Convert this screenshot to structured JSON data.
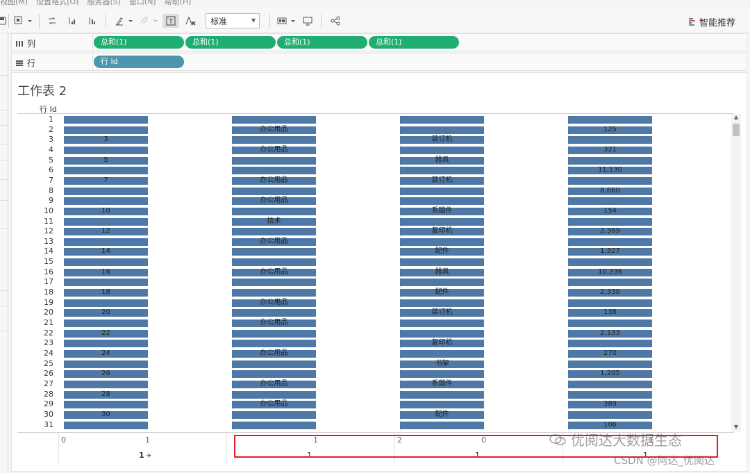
{
  "menu": [
    "视图(M)",
    "设置格式(O)",
    "服务器(S)",
    "窗口(N)",
    "帮助(H)"
  ],
  "toolbar": {
    "mark_type_select": "标准",
    "smart_recommend": "智能推荐"
  },
  "shelves": {
    "columns_label": "列",
    "rows_label": "行",
    "column_pills": [
      "总和(1)",
      "总和(1)",
      "总和(1)",
      "总和(1)"
    ],
    "row_pill": "行 Id"
  },
  "sheet": {
    "title": "工作表 2",
    "row_header": "行 Id",
    "bar_color": "#4e79a7"
  },
  "rows": [
    {
      "id": "1",
      "c1": "",
      "c2": "",
      "c3": "",
      "c4": ""
    },
    {
      "id": "2",
      "c1": "",
      "c2": "办公用品",
      "c3": "",
      "c4": "125"
    },
    {
      "id": "3",
      "c1": "3",
      "c2": "",
      "c3": "装订机",
      "c4": ""
    },
    {
      "id": "4",
      "c1": "",
      "c2": "办公用品",
      "c3": "",
      "c4": "321"
    },
    {
      "id": "5",
      "c1": "5",
      "c2": "",
      "c3": "器具",
      "c4": ""
    },
    {
      "id": "6",
      "c1": "",
      "c2": "",
      "c3": "",
      "c4": "11,130"
    },
    {
      "id": "7",
      "c1": "7",
      "c2": "办公用品",
      "c3": "装订机",
      "c4": ""
    },
    {
      "id": "8",
      "c1": "",
      "c2": "",
      "c3": "",
      "c4": "8,660"
    },
    {
      "id": "9",
      "c1": "",
      "c2": "办公用品",
      "c3": "",
      "c4": ""
    },
    {
      "id": "10",
      "c1": "10",
      "c2": "",
      "c3": "系固件",
      "c4": "154"
    },
    {
      "id": "11",
      "c1": "",
      "c2": "技术",
      "c3": "",
      "c4": ""
    },
    {
      "id": "12",
      "c1": "12",
      "c2": "",
      "c3": "复印机",
      "c4": "2,369"
    },
    {
      "id": "13",
      "c1": "",
      "c2": "办公用品",
      "c3": "",
      "c4": ""
    },
    {
      "id": "14",
      "c1": "14",
      "c2": "",
      "c3": "配件",
      "c4": "1,327"
    },
    {
      "id": "15",
      "c1": "",
      "c2": "",
      "c3": "",
      "c4": ""
    },
    {
      "id": "16",
      "c1": "16",
      "c2": "办公用品",
      "c3": "器具",
      "c4": "10,336"
    },
    {
      "id": "17",
      "c1": "",
      "c2": "",
      "c3": "",
      "c4": ""
    },
    {
      "id": "18",
      "c1": "18",
      "c2": "",
      "c3": "配件",
      "c4": "2,330"
    },
    {
      "id": "19",
      "c1": "",
      "c2": "办公用品",
      "c3": "",
      "c4": ""
    },
    {
      "id": "20",
      "c1": "20",
      "c2": "",
      "c3": "装订机",
      "c4": "138"
    },
    {
      "id": "21",
      "c1": "",
      "c2": "办公用品",
      "c3": "",
      "c4": ""
    },
    {
      "id": "22",
      "c1": "22",
      "c2": "",
      "c3": "",
      "c4": "2,133"
    },
    {
      "id": "23",
      "c1": "",
      "c2": "",
      "c3": "复印机",
      "c4": ""
    },
    {
      "id": "24",
      "c1": "24",
      "c2": "办公用品",
      "c3": "",
      "c4": "270"
    },
    {
      "id": "25",
      "c1": "",
      "c2": "",
      "c3": "书架",
      "c4": ""
    },
    {
      "id": "26",
      "c1": "26",
      "c2": "",
      "c3": "",
      "c4": "1,205"
    },
    {
      "id": "27",
      "c1": "",
      "c2": "办公用品",
      "c3": "系固件",
      "c4": ""
    },
    {
      "id": "28",
      "c1": "28",
      "c2": "",
      "c3": "",
      "c4": ""
    },
    {
      "id": "29",
      "c1": "",
      "c2": "办公用品",
      "c3": "",
      "c4": "389"
    },
    {
      "id": "30",
      "c1": "30",
      "c2": "",
      "c3": "配件",
      "c4": ""
    },
    {
      "id": "31",
      "c1": "",
      "c2": "",
      "c3": "",
      "c4": "106"
    }
  ],
  "axes": [
    {
      "min": "0",
      "max": "1",
      "title": "1"
    },
    {
      "min": "",
      "max": "1",
      "title": "1"
    },
    {
      "min": "2",
      "max": "0",
      "title": "1"
    },
    {
      "min": "",
      "max": "1",
      "title": "1"
    }
  ],
  "axis_pin_icon": "pin-icon",
  "watermark": {
    "line1": "优阅达大数据生态",
    "line2": "CSDN @阿达_优阅达"
  },
  "highlight_color": "#e02020"
}
